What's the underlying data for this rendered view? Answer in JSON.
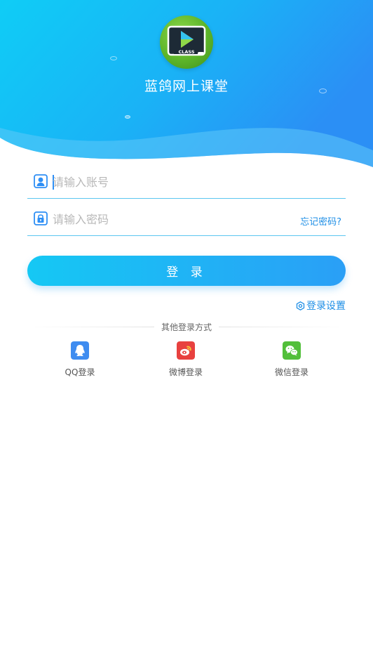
{
  "app": {
    "title": "蓝鸽网上课堂",
    "logo_text": "CLASS"
  },
  "account": {
    "placeholder": "请输入账号",
    "value": ""
  },
  "password": {
    "placeholder": "请输入密码",
    "value": "",
    "forgot_label": "忘记密码?"
  },
  "login_button": {
    "label": "登 录"
  },
  "login_settings": {
    "label": "登录设置"
  },
  "other_login": {
    "label": "其他登录方式",
    "items": [
      {
        "label": "QQ登录",
        "icon": "qq-icon",
        "color": "#3e8cf0"
      },
      {
        "label": "微博登录",
        "icon": "weibo-icon",
        "color": "#e8413f"
      },
      {
        "label": "微信登录",
        "icon": "wechat-icon",
        "color": "#52bf3a"
      }
    ]
  },
  "colors": {
    "accent": "#1d8ee6",
    "header_start": "#0ecbf5",
    "header_end": "#2b8ff5"
  }
}
